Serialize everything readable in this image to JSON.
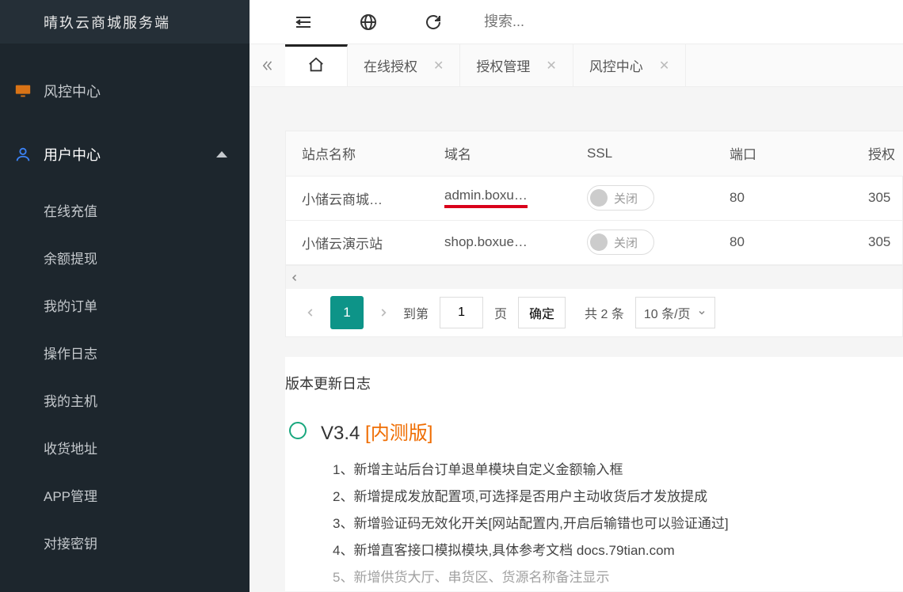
{
  "brand": "晴玖云商城服务端",
  "sidebar": {
    "item0": {
      "label": "风控中心"
    },
    "item1": {
      "label": "用户中心"
    },
    "sub": {
      "s0": "在线充值",
      "s1": "余额提现",
      "s2": "我的订单",
      "s3": "操作日志",
      "s4": "我的主机",
      "s5": "收货地址",
      "s6": "APP管理",
      "s7": "对接密钥"
    }
  },
  "search_placeholder": "搜索...",
  "tabs": {
    "t0": "在线授权",
    "t1": "授权管理",
    "t2": "风控中心"
  },
  "table": {
    "h0": "站点名称",
    "h1": "域名",
    "h2": "SSL",
    "h3": "端口",
    "h4": "授权",
    "r0": {
      "name": "小储云商城…",
      "domain": "admin.boxu…",
      "ssl": "关闭",
      "port": "80",
      "auth": "305"
    },
    "r1": {
      "name": "小储云演示站",
      "domain": "shop.boxue…",
      "ssl": "关闭",
      "port": "80",
      "auth": "305"
    }
  },
  "pager": {
    "current": "1",
    "goto_label": "到第",
    "goto_value": "1",
    "page_label": "页",
    "ok": "确定",
    "total": "共 2 条",
    "per_page": "10 条/页"
  },
  "log": {
    "title": "版本更新日志",
    "version": "V3.4",
    "version_tag": "[内测版]",
    "items": {
      "i0": "1、新增主站后台订单退单模块自定义金额输入框",
      "i1": "2、新增提成发放配置项,可选择是否用户主动收货后才发放提成",
      "i2": "3、新增验证码无效化开关[网站配置内,开启后输错也可以验证通过]",
      "i3": "4、新增直客接口模拟模块,具体参考文档 docs.79tian.com",
      "i4": "5、新增供货大厅、串货区、货源名称备注显示"
    }
  }
}
